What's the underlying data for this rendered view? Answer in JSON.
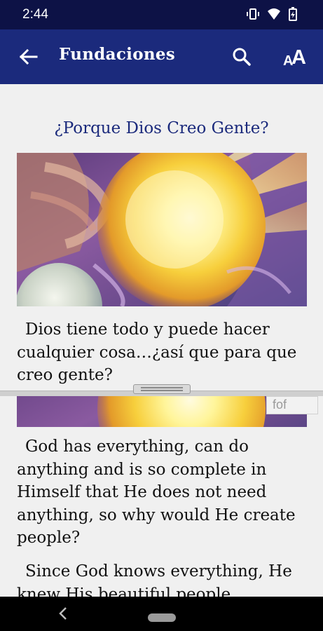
{
  "status_bar": {
    "time": "2:44",
    "icons": [
      "vibrate-icon",
      "wifi-icon",
      "battery-icon"
    ]
  },
  "app_bar": {
    "title": "Fundaciones",
    "back_icon": "arrow-back-icon",
    "search_icon": "search-icon",
    "font_size_icon": "font-size-icon",
    "font_size_small": "A",
    "font_size_big": "A",
    "color": "#1b2a7c"
  },
  "top_pane": {
    "heading": "¿Porque Dios Creo Gente?",
    "paragraph": "Dios tiene todo y puede hacer cualquier cosa…¿así que para que creo gente?"
  },
  "bottom_pane": {
    "version_label": "fof",
    "paragraphs": [
      "God has everything, can do anything and is so complete in Himself that He does not need anything, so why would He create people?",
      "Since God knows everything, He knew His beautiful people"
    ]
  },
  "nav_bar": {
    "back_icon": "nav-back-icon",
    "home_icon": "home-pill-icon"
  }
}
